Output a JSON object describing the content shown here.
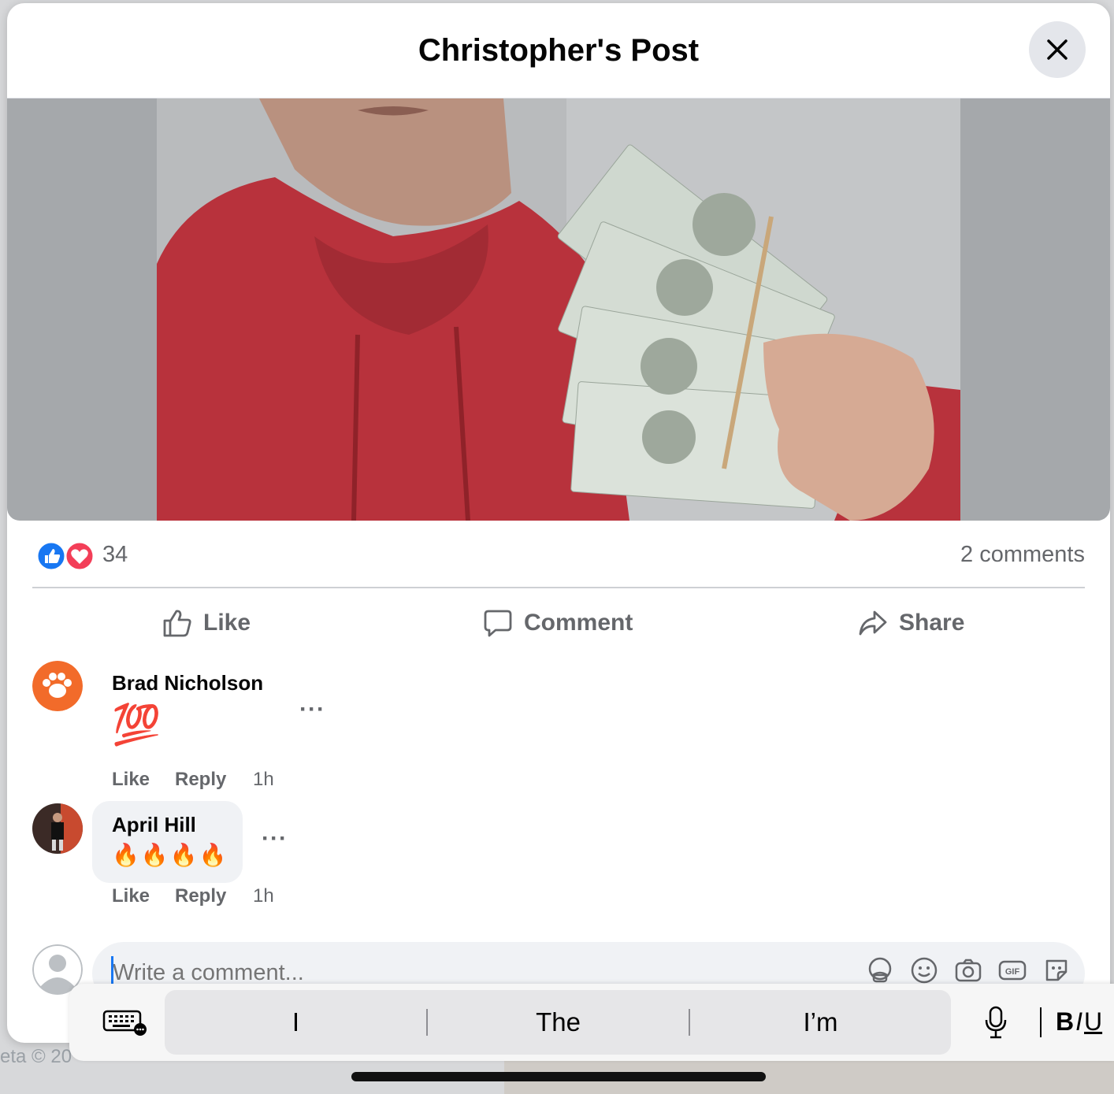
{
  "backdrop": {
    "bottom_left_text": "eta © 20"
  },
  "post": {
    "title": "Christopher's Post",
    "reaction_count": "34",
    "comments_count": "2 comments",
    "actions": {
      "like": "Like",
      "comment": "Comment",
      "share": "Share"
    }
  },
  "comments": [
    {
      "name": "Brad Nicholson",
      "text": "💯",
      "like": "Like",
      "reply": "Reply",
      "time": "1h"
    },
    {
      "name": "April Hill",
      "text": "🔥🔥🔥🔥",
      "like": "Like",
      "reply": "Reply",
      "time": "1h"
    }
  ],
  "composer": {
    "placeholder": "Write a comment..."
  },
  "keyboard": {
    "suggestions": [
      "I",
      "The",
      "I’m"
    ],
    "format": {
      "bold": "B",
      "italic": "I",
      "underline": "U"
    }
  },
  "colors": {
    "accent": "#1877f2",
    "love": "#f33e58",
    "hoodie": "#b8323c"
  },
  "icons": [
    "close-icon",
    "like-reaction-icon",
    "love-reaction-icon",
    "thumbs-up-icon",
    "comment-icon",
    "share-icon",
    "avatar-icon",
    "sticker-icon",
    "emoji-icon",
    "camera-icon",
    "gif-icon",
    "keyboard-icon",
    "microphone-icon"
  ]
}
